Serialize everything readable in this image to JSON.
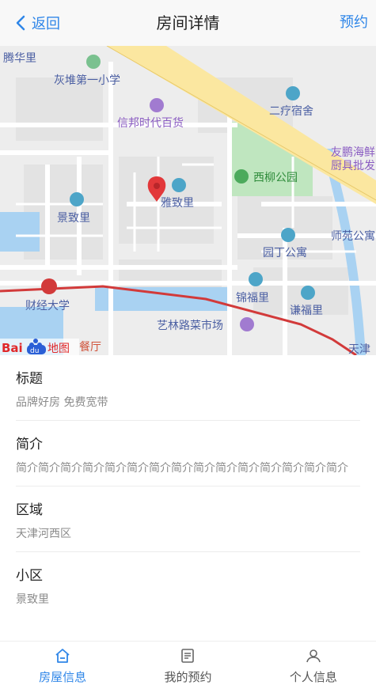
{
  "navbar": {
    "back_label": "返回",
    "title": "房间详情",
    "action_label": "预约"
  },
  "map": {
    "labels": {
      "tenghuali": "腾华里",
      "school": "灰堆第一小学",
      "store": "信邦时代百货",
      "dorm": "二疗宿舍",
      "company_line1": "友鹏海鲜",
      "company_line2": "厨具批发",
      "park": "西柳公园",
      "yazhili": "雅致里",
      "jingzhili": "景致里",
      "shiyuan": "师苑公寓",
      "yuanding": "园丁公寓",
      "jinfuli": "锦福里",
      "qianfuli": "谦福里",
      "university": "财经大学",
      "market": "艺林路菜市场",
      "tianjin": "天津",
      "restaurant": "餐厅"
    },
    "logo": {
      "bai": "Bai",
      "du": "du",
      "ditu": "地图"
    },
    "colors": {
      "road_main": "#fbe7a0",
      "rail": "#d23a3a",
      "water": "#a9d2f2",
      "park": "#bfe6bf"
    }
  },
  "fields": [
    {
      "label": "标题",
      "value": "品牌好房 免费宽带"
    },
    {
      "label": "简介",
      "value": "简介简介简介简介简介简介简介简介简介简介简介简介简介简介简介"
    },
    {
      "label": "区域",
      "value": "天津河西区"
    },
    {
      "label": "小区",
      "value": "景致里"
    }
  ],
  "tabbar": {
    "items": [
      {
        "label": "房屋信息",
        "icon": "home-icon",
        "active": true
      },
      {
        "label": "我的预约",
        "icon": "document-icon",
        "active": false
      },
      {
        "label": "个人信息",
        "icon": "user-icon",
        "active": false
      }
    ],
    "active_color": "#2f86e8"
  }
}
